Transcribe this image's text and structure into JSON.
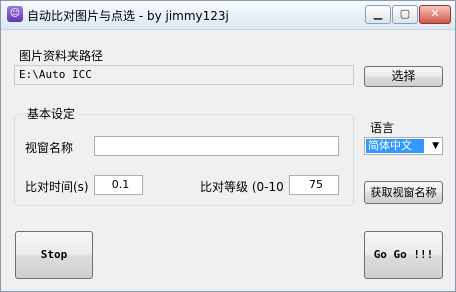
{
  "window": {
    "title": "自动比对图片与点选 - by jimmy123j",
    "icon_glyph": "☺"
  },
  "folder": {
    "label": "图片资料夹路径",
    "path": "E:\\Auto ICC",
    "browse_label": "选择"
  },
  "settings": {
    "group_title": "基本设定",
    "window_name_label": "视窗名称",
    "window_name_value": "",
    "interval_label": "比对时间(s)",
    "interval_value": "0.1",
    "level_label": "比对等级 (0-10",
    "level_value": "75"
  },
  "language": {
    "label": "语言",
    "selected": "简体中文"
  },
  "buttons": {
    "get_window_name": "获取视窗名称",
    "stop": "Stop",
    "go": "Go Go !!!"
  }
}
